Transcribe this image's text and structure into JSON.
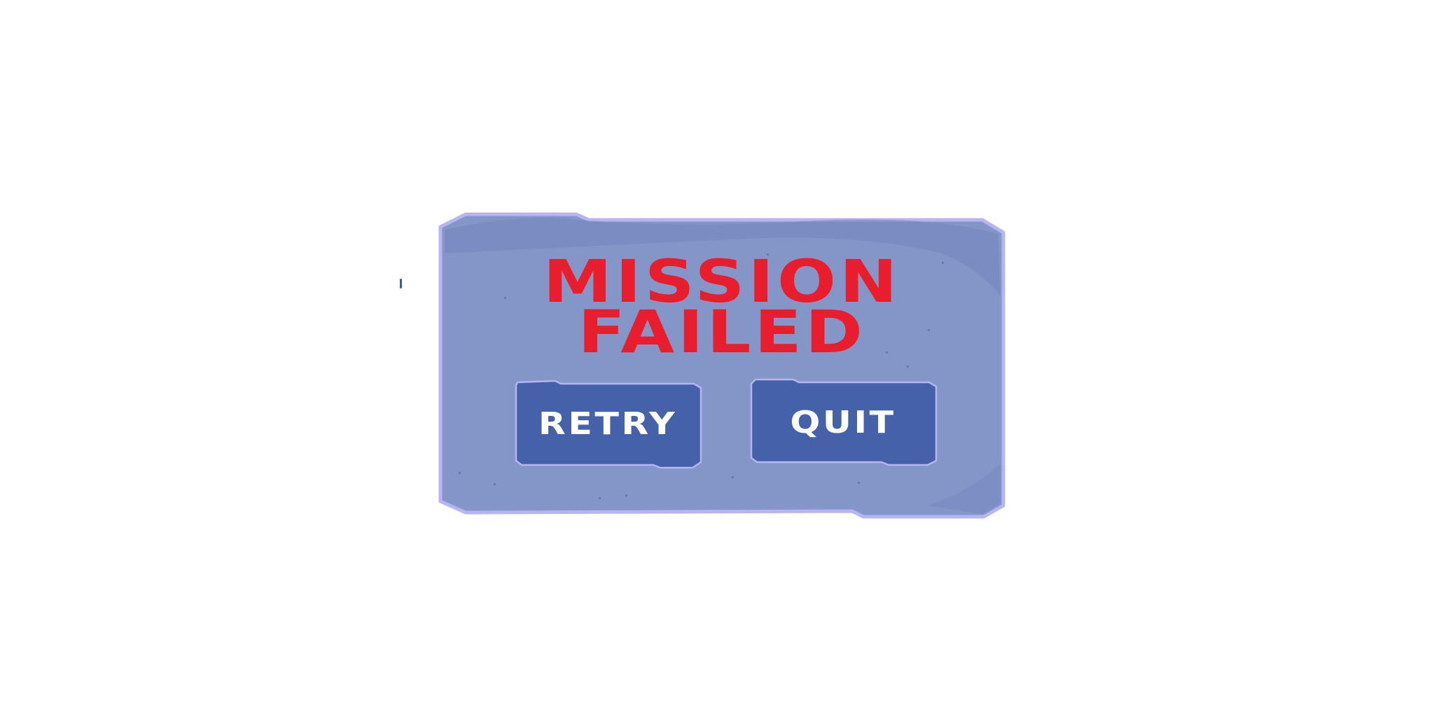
{
  "dialog": {
    "title_line_1": "MISSION",
    "title_line_2": "FAILED",
    "retry_label": "RETRY",
    "quit_label": "QUIT"
  },
  "colors": {
    "background": "#ffffff",
    "panel_fill": "#8496c8",
    "panel_border": "#b6b4f2",
    "title": "#ea1d2c",
    "button_fill": "#4561aa",
    "button_border": "#b6b4f2",
    "button_text": "#ffffff"
  }
}
